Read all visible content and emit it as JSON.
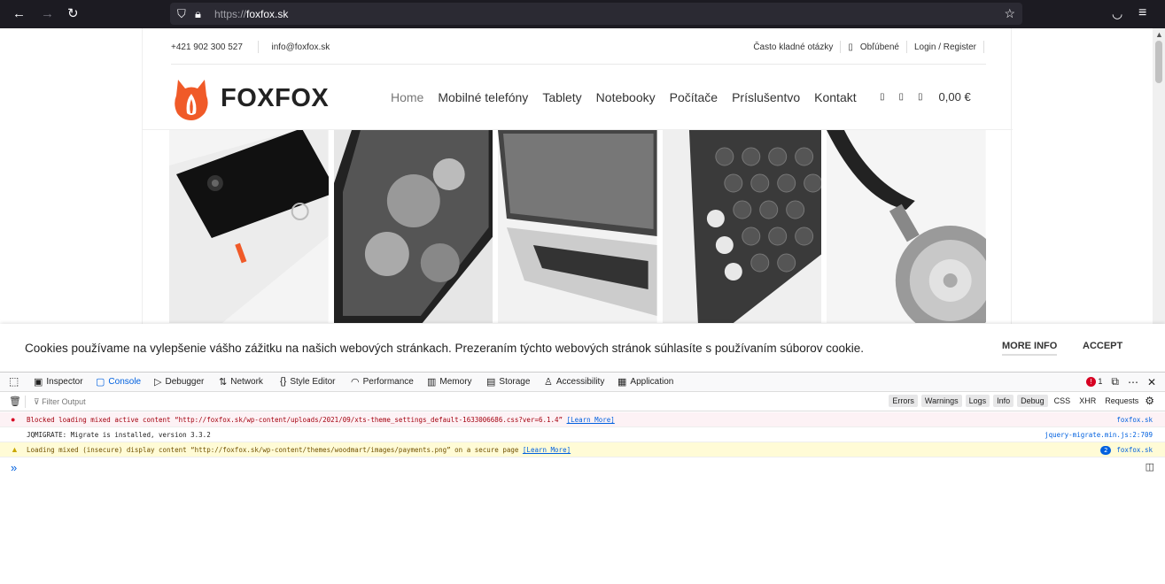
{
  "browser": {
    "back_icon": "←",
    "forward_icon": "→",
    "reload_icon": "↻",
    "url_prefix": "https://",
    "url_host": "foxfox.sk",
    "star_icon": "☆",
    "pocket_icon": "◡",
    "menu_icon": "≡"
  },
  "site": {
    "phone": "+421 902 300 527",
    "email": "info@foxfox.sk",
    "top_links": {
      "faq": "Často kladné otázky",
      "wishlist_icon": "▯",
      "wishlist": "Obľúbené",
      "login": "Login / Register"
    },
    "brand": "FOXFOX",
    "nav": [
      "Home",
      "Mobilné telefóny",
      "Tablety",
      "Notebooky",
      "Počítače",
      "Príslušentvo",
      "Kontakt"
    ],
    "header_icons": [
      "▯",
      "▯",
      "▯"
    ],
    "cart_total": "0,00 €",
    "accent_color": "#f05a28"
  },
  "cookie": {
    "message": "Cookies používame na vylepšenie vášho zážitku na našich webových stránkach. Prezeraním týchto webových stránok súhlasíte s používaním súborov cookie.",
    "more_info": "MORE INFO",
    "accept": "ACCEPT"
  },
  "devtools": {
    "tabs": [
      "Inspector",
      "Console",
      "Debugger",
      "Network",
      "Style Editor",
      "Performance",
      "Memory",
      "Storage",
      "Accessibility",
      "Application"
    ],
    "error_count": "1",
    "filter_placeholder": "Filter Output",
    "filter_buttons": [
      "Errors",
      "Warnings",
      "Logs",
      "Info",
      "Debug"
    ],
    "filter_plain": [
      "CSS",
      "XHR",
      "Requests"
    ],
    "messages": {
      "error": {
        "text": "Blocked loading mixed active content “http://foxfox.sk/wp-content/uploads/2021/09/xts-theme_settings_default-1633006686.css?ver=6.1.4”",
        "link": "[Learn More]",
        "source": "foxfox.sk"
      },
      "log": {
        "text": "JQMIGRATE: Migrate is installed, version 3.3.2",
        "source": "jquery-migrate.min.js:2:709"
      },
      "warning": {
        "text": "Loading mixed (insecure) display content “http://foxfox.sk/wp-content/themes/woodmart/images/payments.png” on a secure page",
        "link": "[Learn More]",
        "count": "2",
        "source": "foxfox.sk"
      }
    },
    "prompt": "»"
  }
}
